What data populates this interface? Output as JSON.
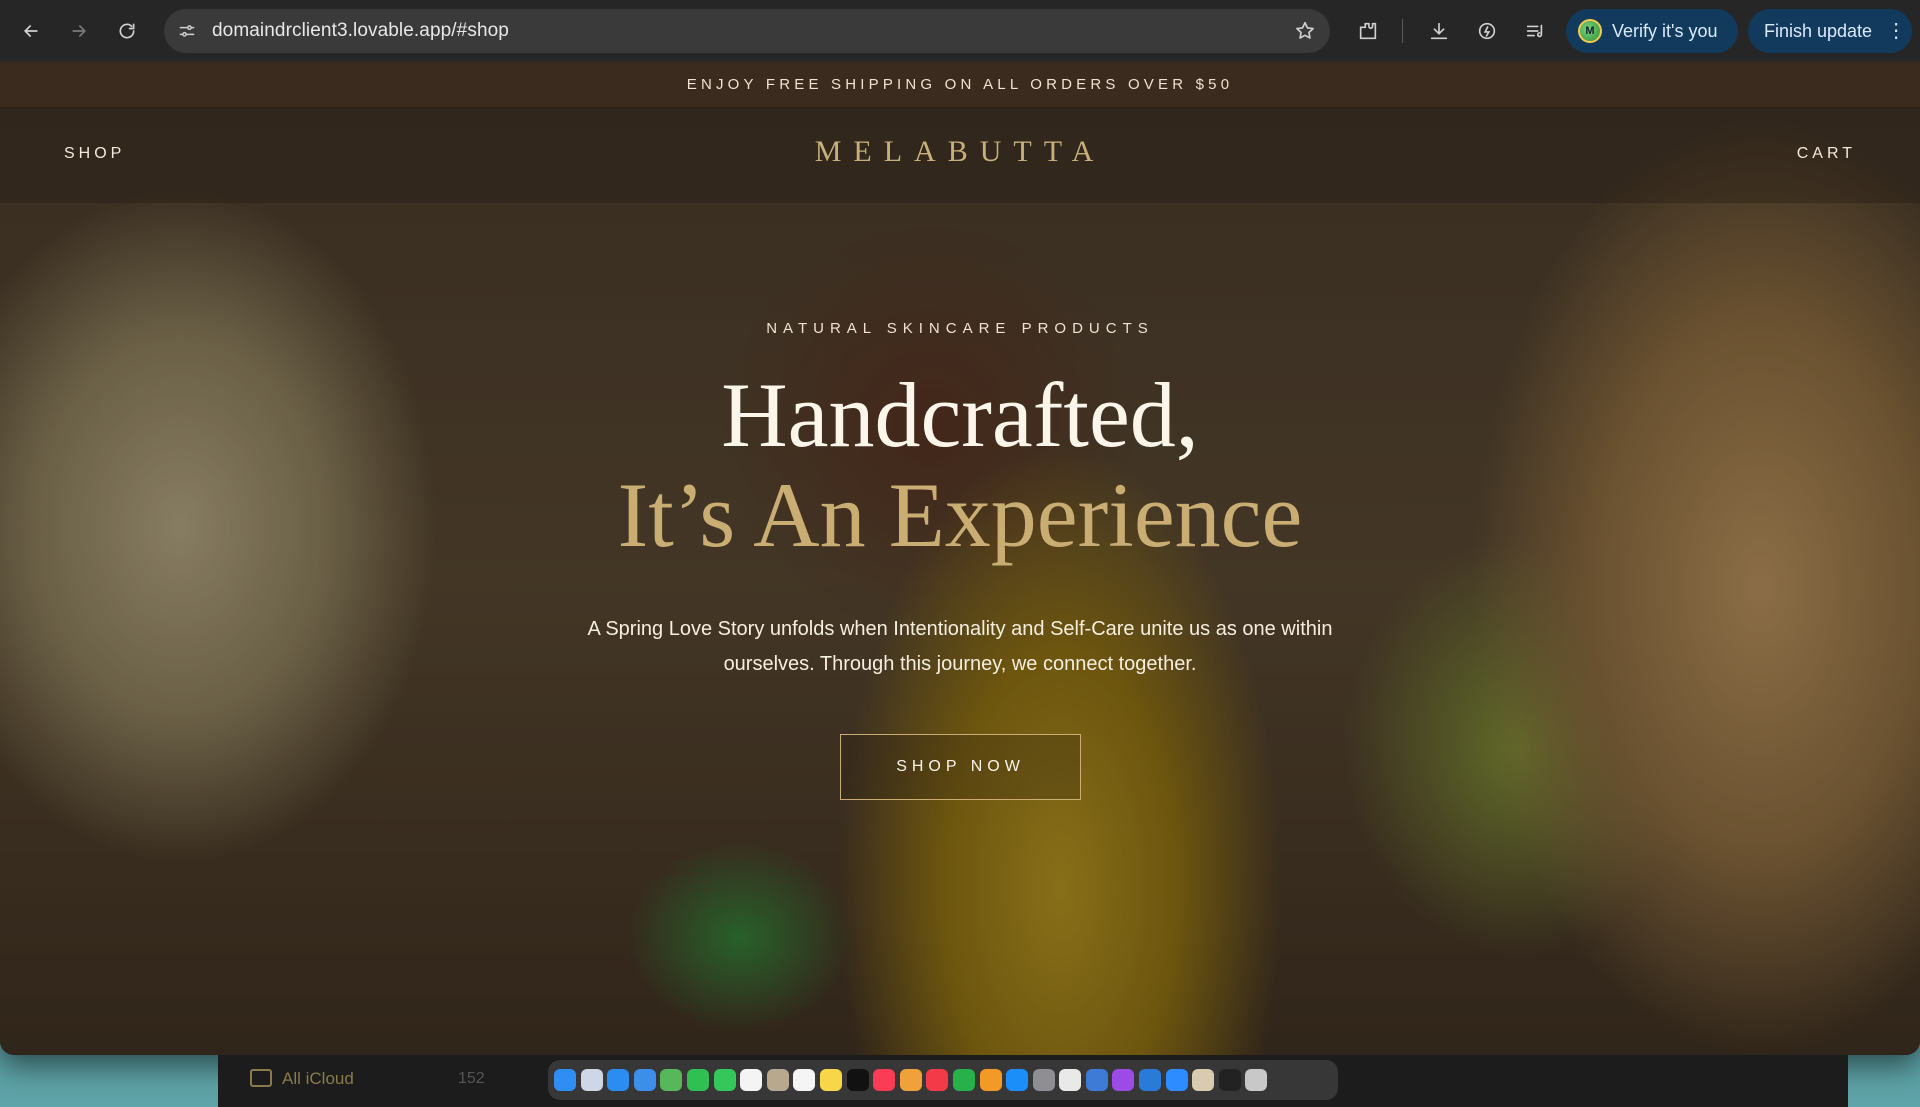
{
  "browser": {
    "url": "domaindrclient3.lovable.app/#shop",
    "verify_label": "Verify it's you",
    "verify_avatar_letter": "M",
    "finish_update_label": "Finish update",
    "menu_glyph": "⋮"
  },
  "site": {
    "announcement": "ENJOY FREE SHIPPING ON ALL ORDERS OVER $50",
    "nav": {
      "shop": "SHOP",
      "brand": "MELABUTTA",
      "cart": "CART"
    },
    "hero": {
      "eyebrow": "NATURAL SKINCARE PRODUCTS",
      "headline_line1": "Handcrafted,",
      "headline_line2": "It’s An Experience",
      "description": "A Spring Love Story unfolds when Intentionality and Self-Care unite us as one within ourselves. Through this journey, we connect together.",
      "cta": "SHOP NOW"
    }
  },
  "desktop": {
    "finder_label": "All iCloud",
    "finder_count": "152",
    "dock_apps": [
      {
        "name": "finder",
        "color": "#2f8ef3"
      },
      {
        "name": "launchpad",
        "color": "#cfd6e6"
      },
      {
        "name": "safari",
        "color": "#2b8cf2"
      },
      {
        "name": "mail",
        "color": "#3b8fe8"
      },
      {
        "name": "maps",
        "color": "#58b75a"
      },
      {
        "name": "facetime",
        "color": "#2fbf52"
      },
      {
        "name": "messages",
        "color": "#34c759"
      },
      {
        "name": "calendar",
        "color": "#f4f4f4"
      },
      {
        "name": "contacts",
        "color": "#b8a98e"
      },
      {
        "name": "reminders",
        "color": "#f5f5f5"
      },
      {
        "name": "notes",
        "color": "#f7d64a"
      },
      {
        "name": "tv",
        "color": "#111111"
      },
      {
        "name": "music",
        "color": "#fa3c55"
      },
      {
        "name": "photos",
        "color": "#f0a23a"
      },
      {
        "name": "news",
        "color": "#f23a48"
      },
      {
        "name": "numbers",
        "color": "#27b14b"
      },
      {
        "name": "pages",
        "color": "#f39a26"
      },
      {
        "name": "app-store",
        "color": "#1c8ef9"
      },
      {
        "name": "system-settings",
        "color": "#8e8e93"
      },
      {
        "name": "chrome",
        "color": "#e9e9e9"
      },
      {
        "name": "preview",
        "color": "#3e7bd6"
      },
      {
        "name": "podcasts",
        "color": "#9b4ce6"
      },
      {
        "name": "proxyman",
        "color": "#2a7bd8"
      },
      {
        "name": "zoom",
        "color": "#2d8cff"
      },
      {
        "name": "image-viewer",
        "color": "#d8cbb0"
      },
      {
        "name": "terminal",
        "color": "#222222"
      },
      {
        "name": "trash",
        "color": "#c8c8c8"
      }
    ]
  }
}
